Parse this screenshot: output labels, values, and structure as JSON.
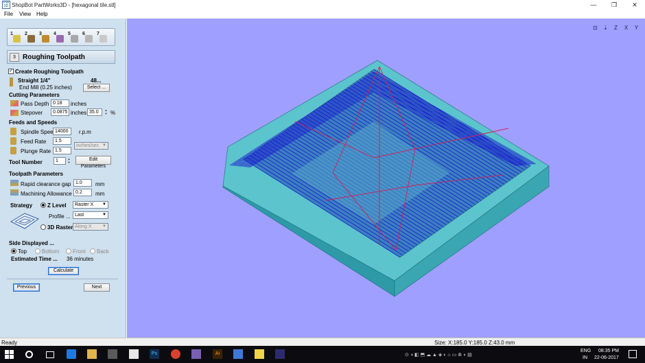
{
  "window": {
    "app_icon_text": "PW 3D",
    "title": "ShopBot PartWorks3D - [hexagonal tile.stl]",
    "minimize": "—",
    "maximize": "❐",
    "close": "✕"
  },
  "menu": [
    "File",
    "View",
    "Help"
  ],
  "steps": [
    {
      "num": "1",
      "color": "#d9c24a"
    },
    {
      "num": "2",
      "color": "#8a6a3a"
    },
    {
      "num": "3",
      "color": "#c48a2a"
    },
    {
      "num": "4",
      "color": "#9a6cae"
    },
    {
      "num": "5",
      "color": "#a8a8a8"
    },
    {
      "num": "6",
      "color": "#b7b7b7"
    },
    {
      "num": "7",
      "color": "#c9c9c9"
    }
  ],
  "page": {
    "icon_num": "3",
    "title": "Roughing Toolpath"
  },
  "create": {
    "checked": "✓",
    "label": "Create Roughing Toolpath"
  },
  "tool": {
    "name": "Straight 1/4\"",
    "value": "48...",
    "desc": "End Mill (0.25 inches)",
    "select_btn": "Select ..."
  },
  "cutting": {
    "heading": "Cutting Parameters",
    "pass_depth_label": "Pass Depth",
    "pass_depth_value": "0.18",
    "pass_depth_unit": "inches",
    "stepover_label": "Stepover",
    "stepover_value": "0.0875",
    "stepover_unit": "inches",
    "stepover_pct": "35.0",
    "pct_sign": "%"
  },
  "feeds": {
    "heading": "Feeds and Speeds",
    "spindle_label": "Spindle Speed",
    "spindle_value": "14000",
    "spindle_unit": "r.p.m",
    "feed_label": "Feed Rate",
    "feed_value": "1.5",
    "plunge_label": "Plunge Rate",
    "plunge_value": "1.5",
    "rate_unit": "inches/sec"
  },
  "toolnum": {
    "label": "Tool Number",
    "value": "1",
    "edit_btn": "Edit Parameters"
  },
  "toolpath_params": {
    "heading": "Toolpath Parameters",
    "rapid_label": "Rapid clearance gap",
    "rapid_value": "1.0",
    "rapid_unit": "mm",
    "allow_label": "Machining Allowance",
    "allow_value": "0.2",
    "allow_unit": "mm"
  },
  "strategy": {
    "heading": "Strategy",
    "zlevel_label": "Z Level",
    "zlevel_combo": "Raster X",
    "profile_label": "Profile ...",
    "profile_combo": "Last",
    "raster_label": "3D Raster",
    "raster_combo": "Along X"
  },
  "side": {
    "heading": "Side Displayed ...",
    "top": "Top",
    "bottom": "Bottom",
    "front": "Front",
    "back": "Back",
    "est_label": "Estimated Time ...",
    "est_value": "36 minutes"
  },
  "buttons": {
    "calculate": "Calculate",
    "previous": "Previous",
    "next": "Next"
  },
  "viewbar": [
    "⊡",
    "⇣",
    "Z",
    "X",
    "Y"
  ],
  "status": {
    "left": "Ready",
    "size": "Size: X:185.0 Y:185.0 Z:43.0 mm"
  },
  "taskbar": {
    "lang": "ENG",
    "region": "IN",
    "time": "08:35 PM",
    "date": "22-06-2017",
    "ps_label": "Ps",
    "ai_label": "Ai"
  },
  "colors": {
    "viewport_bg": "#9f9fff",
    "panel_bg": "#cfe0ee",
    "block_top": "#5cc4cc",
    "block_side": "#3aa6b2",
    "toolpath": "#1a1ad0",
    "highlight": "#d0205a"
  }
}
